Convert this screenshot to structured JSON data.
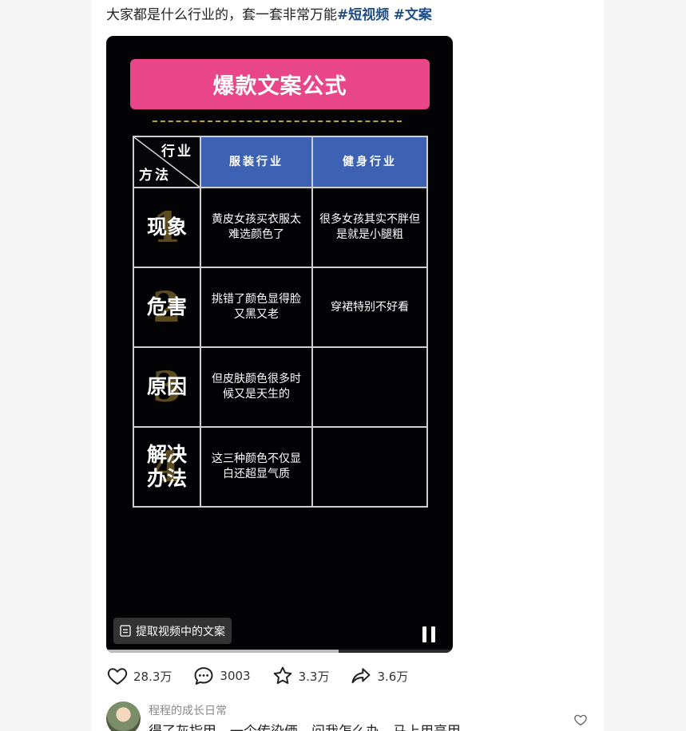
{
  "post": {
    "caption_text": "大家都是什么行业的，套一套非常万能",
    "hashtags": [
      "#短视频",
      "#文案"
    ]
  },
  "video": {
    "banner_title": "爆款文案公式",
    "table": {
      "corner_top": "行业",
      "corner_bottom": "方法",
      "columns": [
        "服装行业",
        "健身行业"
      ],
      "rows": [
        {
          "label": "现象",
          "num": "1",
          "cells": [
            "黄皮女孩买衣服太难选颜色了",
            "很多女孩其实不胖但是就是小腿粗"
          ]
        },
        {
          "label": "危害",
          "num": "2",
          "cells": [
            "挑错了颜色显得脸又黑又老",
            "穿裙特别不好看"
          ]
        },
        {
          "label": "原因",
          "num": "3",
          "cells": [
            "但皮肤颜色很多时候又是天生的",
            ""
          ]
        },
        {
          "label": "解决办法",
          "num": "4",
          "cells": [
            "这三种颜色不仅显白还超显气质",
            ""
          ]
        }
      ]
    },
    "extract_button_label": "提取视频中的文案",
    "progress": 0.67
  },
  "actions": {
    "like_count": "28.3万",
    "comment_count": "3003",
    "favorite_count": "3.3万",
    "share_count": "3.6万"
  },
  "comment": {
    "username": "程程的成长日常",
    "text": "得了灰指甲，一个传染俩，问我怎么办，马上用亮甲"
  }
}
